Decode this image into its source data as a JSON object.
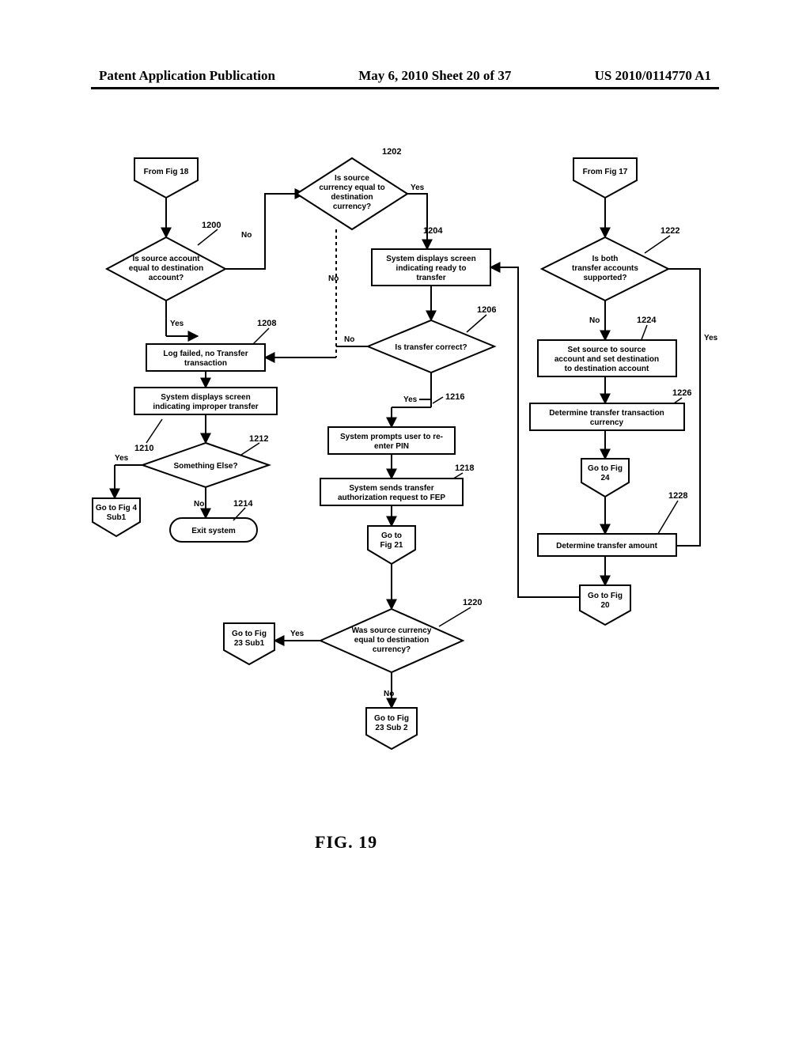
{
  "header": {
    "left": "Patent Application Publication",
    "center": "May 6, 2010  Sheet 20 of 37",
    "right": "US 2010/0114770 A1"
  },
  "figure_caption": "FIG. 19",
  "refs": {
    "r1200": "1200",
    "r1202": "1202",
    "r1204": "1204",
    "r1206": "1206",
    "r1208": "1208",
    "r1210": "1210",
    "r1212": "1212",
    "r1214": "1214",
    "r1216": "1216",
    "r1218": "1218",
    "r1220": "1220",
    "r1222": "1222",
    "r1224": "1224",
    "r1226": "1226",
    "r1228": "1228"
  },
  "nodes": {
    "from18": "From Fig 18",
    "from17": "From Fig 17",
    "d1200a": "Is source account",
    "d1200b": "equal to destination",
    "d1200c": "account?",
    "d1202a": "Is source",
    "d1202b": "currency equal to",
    "d1202c": "destination",
    "d1202d": "currency?",
    "p1204a": "System displays screen",
    "p1204b": "indicating ready to",
    "p1204c": "transfer",
    "d1206": "Is transfer correct?",
    "p1208a": "Log failed,  no Transfer",
    "p1208b": "transaction",
    "p1210a": "System displays screen",
    "p1210b": "indicating improper transfer",
    "d1212": "Something Else?",
    "t1214": "Exit system",
    "p1216a": "System prompts user to re-",
    "p1216b": "enter PIN",
    "p1218a": "System sends transfer",
    "p1218b": "authorization request to FEP",
    "d1220a": "Was source currency",
    "d1220b": "equal to destination",
    "d1220c": "currency?",
    "d1222a": "Is both",
    "d1222b": "transfer accounts",
    "d1222c": "supported?",
    "p1224a": "Set source to source",
    "p1224b": "account and set destination",
    "p1224c": "to destination account",
    "p1226a": "Determine transfer transaction",
    "p1226b": "currency",
    "p1228": "Determine transfer amount",
    "go4": "Go to Fig 4",
    "go4b": "Sub1",
    "go20": "Go to Fig",
    "go20b": "20",
    "go21": "Go to",
    "go21b": "Fig 21",
    "go23a": "Go to Fig",
    "go23a2": "23 Sub1",
    "go23b": "Go to Fig",
    "go23b2": "23 Sub 2",
    "go24": "Go to Fig",
    "go24b": "24"
  },
  "edges": {
    "yes": "Yes",
    "no": "No"
  }
}
